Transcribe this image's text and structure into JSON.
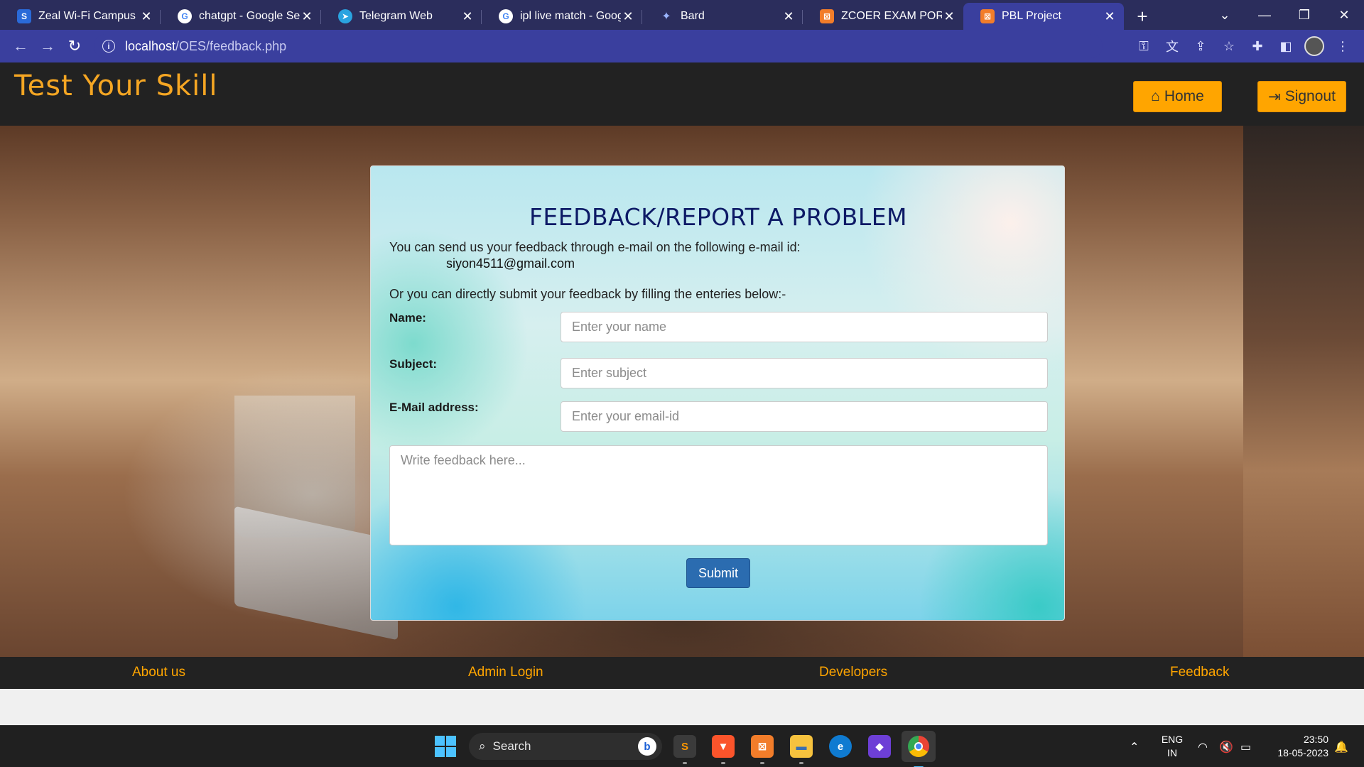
{
  "browser": {
    "tabs": [
      {
        "title": "Zeal Wi-Fi Campus",
        "favicon": "S",
        "favicon_bg": "#2a6ad8"
      },
      {
        "title": "chatgpt - Google Search",
        "favicon": "G",
        "favicon_bg": "#ffffff"
      },
      {
        "title": "Telegram Web",
        "favicon": "➤",
        "favicon_bg": "#2aa3e0"
      },
      {
        "title": "ipl live match - Google Search",
        "favicon": "G",
        "favicon_bg": "#ffffff"
      },
      {
        "title": "Bard",
        "favicon": "✦",
        "favicon_bg": "#2b2d5c"
      },
      {
        "title": "ZCOER EXAM PORTAL",
        "favicon": "⊠",
        "favicon_bg": "#f27d2a"
      },
      {
        "title": "PBL Project",
        "favicon": "⊠",
        "favicon_bg": "#f27d2a"
      }
    ],
    "active_tab_index": 6,
    "url_host": "localhost",
    "url_path": "/OES/feedback.php"
  },
  "site": {
    "brand": "Test Your Skill",
    "home_label": "Home",
    "signout_label": "Signout"
  },
  "form": {
    "title": "FEEDBACK/REPORT A PROBLEM",
    "intro": "You can send us your feedback through e-mail on the following e-mail id:",
    "email": "siyon4511@gmail.com",
    "or_text": "Or you can directly submit your feedback by filling the enteries below:-",
    "name_label": "Name:",
    "name_placeholder": "Enter your name",
    "subject_label": "Subject:",
    "subject_placeholder": "Enter subject",
    "email_label": "E-Mail address:",
    "email_placeholder": "Enter your email-id",
    "feedback_placeholder": "Write feedback here...",
    "submit_label": "Submit"
  },
  "footer": {
    "about": "About us",
    "admin": "Admin Login",
    "developers": "Developers",
    "feedback": "Feedback"
  },
  "taskbar": {
    "search_label": "Search",
    "lang_top": "ENG",
    "lang_bottom": "IN",
    "time": "23:50",
    "date": "18-05-2023"
  },
  "colors": {
    "accent_orange": "#ffa500",
    "title_navy": "#0d1a66",
    "browser_frame": "#3a3f9e"
  }
}
